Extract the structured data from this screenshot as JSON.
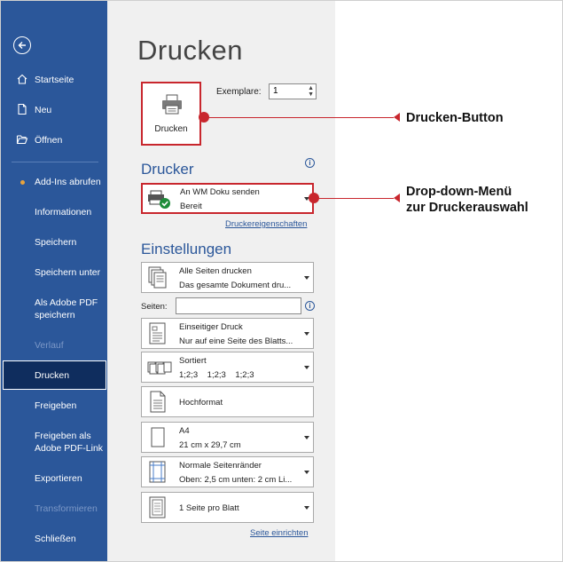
{
  "sidebar": {
    "items": [
      {
        "label": "Startseite",
        "icon": "home-icon"
      },
      {
        "label": "Neu",
        "icon": "new-document-icon"
      },
      {
        "label": "Öffnen",
        "icon": "open-folder-icon"
      },
      {
        "label": "Add-Ins abrufen"
      },
      {
        "label": "Informationen"
      },
      {
        "label": "Speichern"
      },
      {
        "label": "Speichern unter"
      },
      {
        "label": "Als Adobe PDF speichern"
      },
      {
        "label": "Verlauf",
        "disabled": true
      },
      {
        "label": "Drucken",
        "active": true
      },
      {
        "label": "Freigeben"
      },
      {
        "label": "Freigeben als Adobe PDF-Link"
      },
      {
        "label": "Exportieren"
      },
      {
        "label": "Transformieren",
        "disabled": true
      },
      {
        "label": "Schließen"
      }
    ]
  },
  "main": {
    "title": "Drucken",
    "print_button_label": "Drucken",
    "copies_label": "Exemplare:",
    "copies_value": "1",
    "printer_heading": "Drucker",
    "printer_name": "An WM Doku senden",
    "printer_status": "Bereit",
    "printer_properties_link": "Druckereigenschaften",
    "settings_heading": "Einstellungen",
    "pages_label": "Seiten:",
    "settings": [
      {
        "line1": "Alle Seiten drucken",
        "line2": "Das gesamte Dokument dru..."
      },
      {
        "line1": "Einseitiger Druck",
        "line2": "Nur auf eine Seite des Blatts..."
      },
      {
        "line1": "Sortiert",
        "line2": "1;2;3    1;2;3    1;2;3"
      },
      {
        "line1": "Hochformat",
        "line2": ""
      },
      {
        "line1": "A4",
        "line2": "21 cm x 29,7 cm"
      },
      {
        "line1": "Normale Seitenränder",
        "line2": "Oben: 2,5 cm unten: 2 cm Li..."
      },
      {
        "line1": "1 Seite pro Blatt",
        "line2": ""
      }
    ],
    "page_setup_link": "Seite einrichten"
  },
  "annotations": {
    "print_button": "Drucken-Button",
    "dropdown_line1": "Drop-down-Menü",
    "dropdown_line2": "zur Druckerauswahl"
  },
  "colors": {
    "sidebar_bg": "#2b579a",
    "active_bg": "#0f2d5e",
    "panel_bg": "#f0f0f0",
    "annotation_red": "#c8262d",
    "heading_blue": "#2b579a"
  }
}
